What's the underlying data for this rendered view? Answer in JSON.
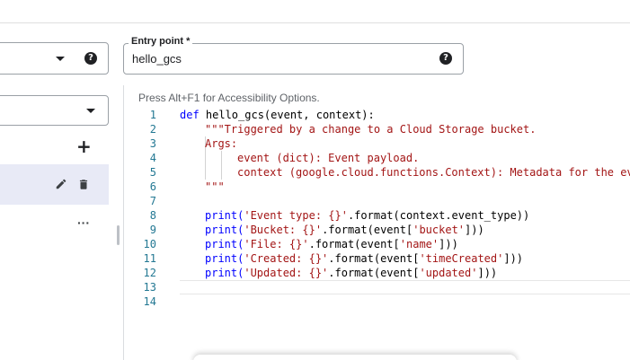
{
  "entry_point": {
    "label": "Entry point *",
    "value": "hello_gcs"
  },
  "editor": {
    "accessibility_hint": "Press Alt+F1 for Accessibility Options.",
    "lines": [
      {
        "n": "1",
        "text": ""
      },
      {
        "n": "2",
        "text": "\"\"\"Triggered by a change to a Cloud Storage bucket."
      },
      {
        "n": "3",
        "text": "Args:"
      },
      {
        "n": "4",
        "text": "event (dict): Event payload."
      },
      {
        "n": "5",
        "text": "context (google.cloud.functions.Context): Metadata for the ev"
      },
      {
        "n": "6",
        "text": "\"\"\""
      },
      {
        "n": "7",
        "text": ""
      },
      {
        "n": "8",
        "text": "print('Event type: {}'.format(context.event_type))"
      },
      {
        "n": "9",
        "text": "print('Bucket: {}'.format(event['bucket']))"
      },
      {
        "n": "10",
        "text": "print('File: {}'.format(event['name']))"
      },
      {
        "n": "11",
        "text": "print('Created: {}'.format(event['timeCreated']))"
      },
      {
        "n": "12",
        "text": "print('Updated: {}'.format(event['updated']))"
      },
      {
        "n": "13",
        "text": ""
      },
      {
        "n": "14",
        "text": ""
      }
    ],
    "line1": {
      "keyword": "def",
      "rest": " hello_gcs(event, context):"
    }
  },
  "icons": {
    "help": "question-circle-icon",
    "caret": "dropdown-arrow-icon",
    "add": "plus-icon",
    "edit": "pencil-icon",
    "delete": "trash-icon",
    "more": "more-horiz-icon"
  },
  "colors": {
    "line_numbers": "#237893",
    "keyword": "#0000ff",
    "string": "#a31515",
    "selected_row": "#e8eaf6"
  }
}
